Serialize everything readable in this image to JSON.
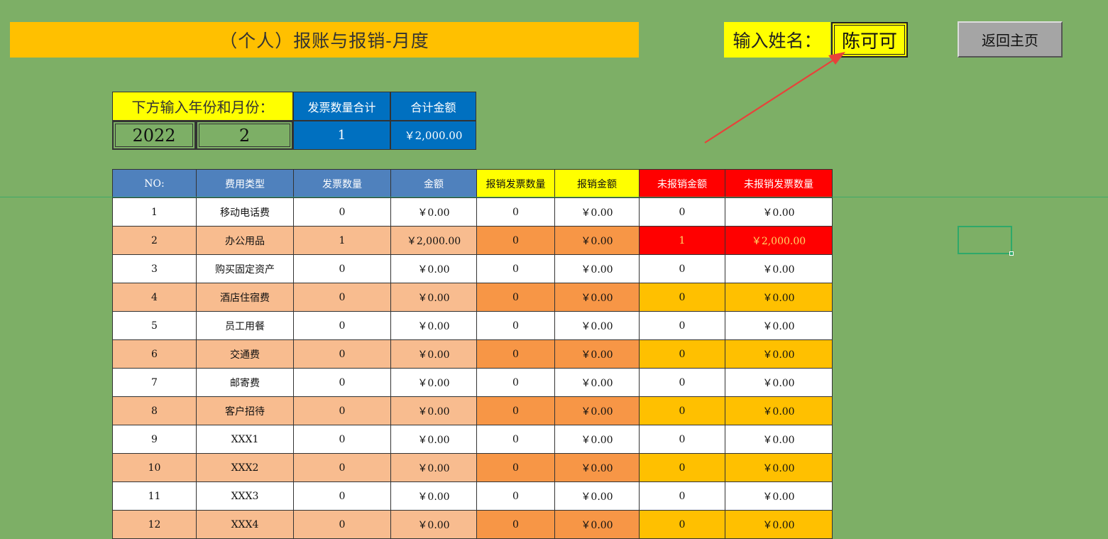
{
  "title": "（个人）报账与报销-月度",
  "name_label": "输入姓名：",
  "name_value": "陈可可",
  "home_button": "返回主页",
  "period": {
    "label": "下方输入年份和月份：",
    "year": "2022",
    "month": "2"
  },
  "summary": {
    "count_label": "发票数量合计",
    "count_value": "1",
    "amount_label": "合计金额",
    "amount_value": "￥2,000.00"
  },
  "colors": {
    "background": "#7daf66",
    "blue_header": "#4f81bd",
    "yellow_header": "#ffff00",
    "red_header": "#ff0000",
    "row_alt": "#f8bc8f",
    "orange_col": "#f79646",
    "amber_col": "#ffc000"
  },
  "table": {
    "headers": [
      "NO:",
      "费用类型",
      "发票数量",
      "金额",
      "报销发票数量",
      "报销金额",
      "未报销金额",
      "未报销发票数量"
    ],
    "rows": [
      [
        "1",
        "移动电话费",
        "0",
        "￥0.00",
        "0",
        "￥0.00",
        "0",
        "￥0.00"
      ],
      [
        "2",
        "办公用品",
        "1",
        "￥2,000.00",
        "0",
        "￥0.00",
        "1",
        "￥2,000.00"
      ],
      [
        "3",
        "购买固定资产",
        "0",
        "￥0.00",
        "0",
        "￥0.00",
        "0",
        "￥0.00"
      ],
      [
        "4",
        "酒店住宿费",
        "0",
        "￥0.00",
        "0",
        "￥0.00",
        "0",
        "￥0.00"
      ],
      [
        "5",
        "员工用餐",
        "0",
        "￥0.00",
        "0",
        "￥0.00",
        "0",
        "￥0.00"
      ],
      [
        "6",
        "交通费",
        "0",
        "￥0.00",
        "0",
        "￥0.00",
        "0",
        "￥0.00"
      ],
      [
        "7",
        "邮寄费",
        "0",
        "￥0.00",
        "0",
        "￥0.00",
        "0",
        "￥0.00"
      ],
      [
        "8",
        "客户招待",
        "0",
        "￥0.00",
        "0",
        "￥0.00",
        "0",
        "￥0.00"
      ],
      [
        "9",
        "XXX1",
        "0",
        "￥0.00",
        "0",
        "￥0.00",
        "0",
        "￥0.00"
      ],
      [
        "10",
        "XXX2",
        "0",
        "￥0.00",
        "0",
        "￥0.00",
        "0",
        "￥0.00"
      ],
      [
        "11",
        "XXX3",
        "0",
        "￥0.00",
        "0",
        "￥0.00",
        "0",
        "￥0.00"
      ],
      [
        "12",
        "XXX4",
        "0",
        "￥0.00",
        "0",
        "￥0.00",
        "0",
        "￥0.00"
      ]
    ]
  }
}
